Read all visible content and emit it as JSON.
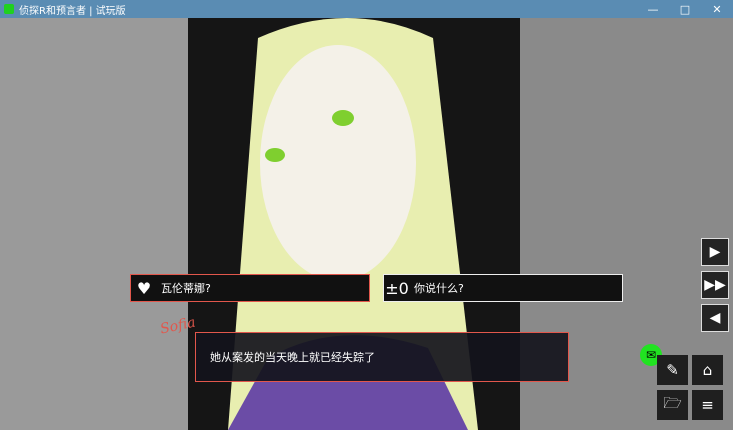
{
  "window": {
    "title": "侦探R和预言者 | 试玩版",
    "controls": [
      "—",
      "□",
      "✕"
    ]
  },
  "choices": [
    {
      "icon": "♥",
      "label": "瓦伦蒂娜?"
    },
    {
      "icon": "±0",
      "label": "你说什么?"
    }
  ],
  "speaker": "Sofia",
  "dialog": "她从案发的当天晚上就已经失踪了",
  "buttons": {
    "play": "▶",
    "fast_forward": "▶▶",
    "back": "◀",
    "eraser": "✎",
    "map": "⌂",
    "folder": "🗁",
    "menu": "≡",
    "mail": "✉"
  },
  "colors": {
    "title_bar": "#5a8cb3",
    "accent": "#e2574c",
    "mail": "#21e321"
  }
}
